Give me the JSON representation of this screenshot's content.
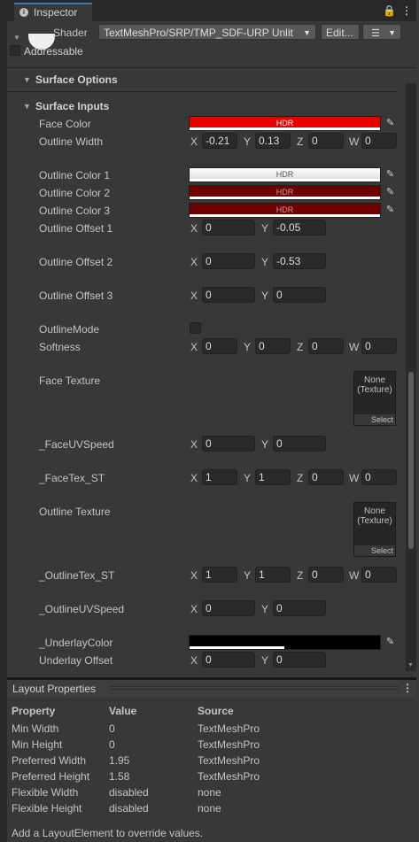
{
  "window": {
    "tab_title": "Inspector",
    "tab_icon": "info-icon",
    "lock_icon": "lock-icon",
    "menu_icon": "kebab-menu-icon",
    "accent_color": "#3a79bb"
  },
  "header": {
    "shader_label": "Shader",
    "shader_value": "TextMeshPro/SRP/TMP_SDF-URP Unlit",
    "edit_label": "Edit...",
    "list_icon": "list-icon",
    "addressable_label": "Addressable",
    "addressable_checked": false
  },
  "sections": {
    "surface_options": "Surface Options",
    "surface_inputs": "Surface Inputs"
  },
  "properties": {
    "face_color": {
      "label": "Face Color",
      "hdr": "HDR",
      "color": "#e60000"
    },
    "outline_width": {
      "label": "Outline Width",
      "x": "-0.21",
      "y": "0.13",
      "z": "0",
      "w": "0"
    },
    "outline_color_1": {
      "label": "Outline Color 1",
      "hdr": "HDR",
      "color": "#ffffff"
    },
    "outline_color_2": {
      "label": "Outline Color 2",
      "hdr": "HDR",
      "color": "#6e0000"
    },
    "outline_color_3": {
      "label": "Outline Color 3",
      "hdr": "HDR",
      "color": "#6e0000"
    },
    "outline_offset_1": {
      "label": "Outline Offset 1",
      "x": "0",
      "y": "-0.05"
    },
    "outline_offset_2": {
      "label": "Outline Offset 2",
      "x": "0",
      "y": "-0.53"
    },
    "outline_offset_3": {
      "label": "Outline Offset 3",
      "x": "0",
      "y": "0"
    },
    "outline_mode": {
      "label": "OutlineMode",
      "checked": false
    },
    "softness": {
      "label": "Softness",
      "x": "0",
      "y": "0",
      "z": "0",
      "w": "0"
    },
    "face_texture": {
      "label": "Face Texture",
      "none": "None",
      "type": "(Texture)",
      "select": "Select"
    },
    "face_uv_speed": {
      "label": "_FaceUVSpeed",
      "x": "0",
      "y": "0"
    },
    "face_tex_st": {
      "label": "_FaceTex_ST",
      "x": "1",
      "y": "1",
      "z": "0",
      "w": "0"
    },
    "outline_texture": {
      "label": "Outline Texture",
      "none": "None",
      "type": "(Texture)",
      "select": "Select"
    },
    "outline_tex_st": {
      "label": "_OutlineTex_ST",
      "x": "1",
      "y": "1",
      "z": "0",
      "w": "0"
    },
    "outline_uv_speed": {
      "label": "_OutlineUVSpeed",
      "x": "0",
      "y": "0"
    },
    "underlay_color": {
      "label": "_UnderlayColor",
      "color": "#000000"
    },
    "underlay_offset": {
      "label": "Underlay Offset",
      "x": "0",
      "y": "0"
    }
  },
  "axis": {
    "x": "X",
    "y": "Y",
    "z": "Z",
    "w": "W"
  },
  "picker_icon": "eyedropper-icon",
  "layout_properties": {
    "title": "Layout Properties",
    "headers": [
      "Property",
      "Value",
      "Source"
    ],
    "rows": [
      [
        "Min Width",
        "0",
        "TextMeshPro"
      ],
      [
        "Min Height",
        "0",
        "TextMeshPro"
      ],
      [
        "Preferred Width",
        "1.95",
        "TextMeshPro"
      ],
      [
        "Preferred Height",
        "1.58",
        "TextMeshPro"
      ],
      [
        "Flexible Width",
        "disabled",
        "none"
      ],
      [
        "Flexible Height",
        "disabled",
        "none"
      ]
    ],
    "footer": "Add a LayoutElement to override values."
  }
}
